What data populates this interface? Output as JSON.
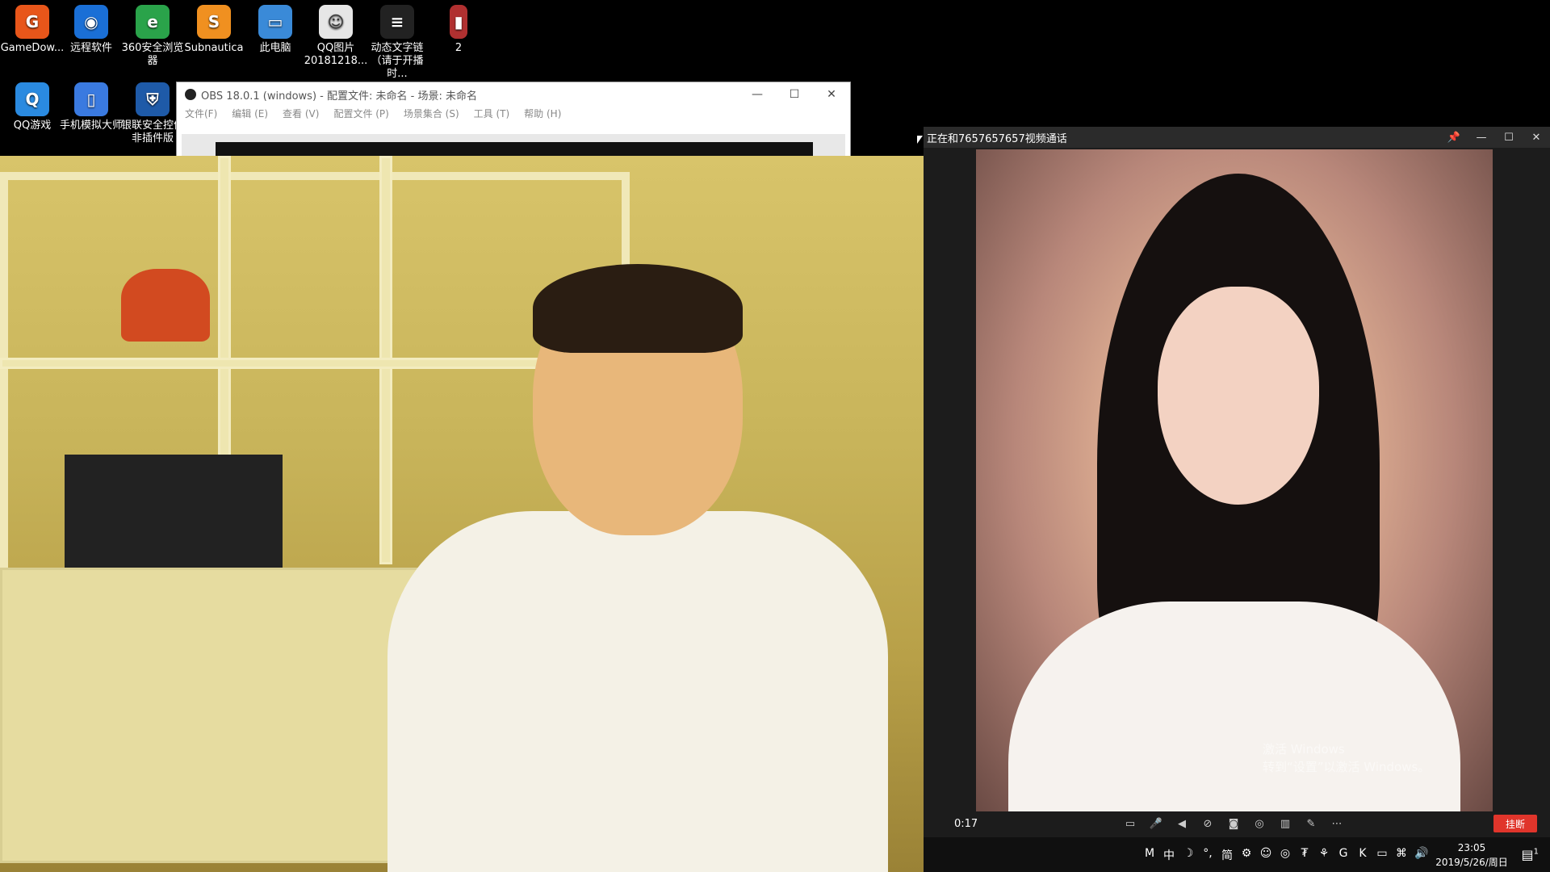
{
  "desktop": {
    "icons": [
      {
        "label": "GameDow...",
        "icon": "gamedownload-icon",
        "color": "#e8561a"
      },
      {
        "label": "远程软件",
        "icon": "remote-software-icon",
        "color": "#1a6fd6"
      },
      {
        "label": "360安全浏览器",
        "icon": "360-browser-icon",
        "color": "#2aa34a"
      },
      {
        "label": "Subnautica",
        "icon": "subnautica-icon",
        "color": "#f09020"
      },
      {
        "label": "此电脑",
        "icon": "this-pc-icon",
        "color": "#3a8ad8"
      },
      {
        "label": "QQ图片20181218...",
        "icon": "image-file-icon",
        "color": "#e6e6e6"
      },
      {
        "label": "动态文字链（请于开播时...",
        "icon": "text-file-icon",
        "color": "#222222"
      },
      {
        "label": "2",
        "icon": "bottle-icon",
        "color": "#b03030"
      },
      {
        "label": "QQ游戏",
        "icon": "qq-game-icon",
        "color": "#2a8ae0"
      },
      {
        "label": "手机模拟大师",
        "icon": "phone-emulator-icon",
        "color": "#3a7ae0"
      },
      {
        "label": "银联安全控件非插件版",
        "icon": "unionpay-shield-icon",
        "color": "#1e5aa8"
      }
    ]
  },
  "obs": {
    "title": "OBS 18.0.1 (windows) - 配置文件: 未命名 - 场景: 未命名",
    "menu": [
      "文件(F)",
      "编辑 (E)",
      "查看 (V)",
      "配置文件 (P)",
      "场景集合 (S)",
      "工具 (T)",
      "帮助 (H)"
    ],
    "buttons": {
      "minimize": "—",
      "maximize": "☐",
      "close": "✕"
    }
  },
  "call": {
    "title": "正在和7657657657视频通话",
    "buttons": {
      "pin": "📌",
      "minimize": "—",
      "maximize": "☐",
      "close": "✕"
    },
    "timer": "0:17",
    "hangup": "挂断",
    "watermark_line1": "激活 Windows",
    "watermark_line2": "转到“设置”以激活 Windows。",
    "controls": [
      "chat-icon",
      "microphone-icon",
      "speaker-icon",
      "camera-off-icon",
      "screenshot-icon",
      "record-icon",
      "layout-icon",
      "edit-icon",
      "more-icon"
    ]
  },
  "taskbar": {
    "tray": [
      "M",
      "中",
      "☽",
      "°,",
      "简",
      "⚙",
      "☺",
      "◎",
      "₮",
      "⚘",
      "G",
      "K",
      "▭",
      "⌘",
      "🔊"
    ],
    "time": "23:05",
    "date": "2019/5/26/周日",
    "notification": "1"
  }
}
